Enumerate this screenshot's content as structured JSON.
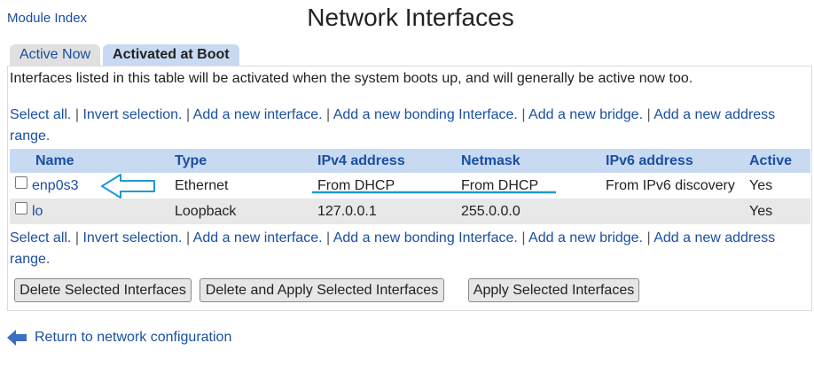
{
  "nav": {
    "module_index": "Module Index"
  },
  "page_title": "Network Interfaces",
  "tabs": [
    {
      "label": "Active Now",
      "active": false
    },
    {
      "label": "Activated at Boot",
      "active": true
    }
  ],
  "description": "Interfaces listed in this table will be activated when the system boots up, and will generally be active now too.",
  "actions": {
    "select_all": "Select all.",
    "invert_selection": "Invert selection.",
    "add_interface": "Add a new interface.",
    "add_bonding": "Add a new bonding Interface.",
    "add_bridge": "Add a new bridge.",
    "add_address_range_1": "Add a new address",
    "add_address_range_2": "range.",
    "separator": "|"
  },
  "table": {
    "headers": [
      "Name",
      "Type",
      "IPv4 address",
      "Netmask",
      "IPv6 address",
      "Active"
    ],
    "rows": [
      {
        "name": "enp0s3",
        "type": "Ethernet",
        "ipv4": "From DHCP",
        "netmask": "From DHCP",
        "ipv6": "From IPv6 discovery",
        "active": "Yes",
        "checked": false
      },
      {
        "name": "lo",
        "type": "Loopback",
        "ipv4": "127.0.0.1",
        "netmask": "255.0.0.0",
        "ipv6": "",
        "active": "Yes",
        "checked": false
      }
    ]
  },
  "buttons": {
    "delete_selected": "Delete Selected Interfaces",
    "delete_apply_selected": "Delete and Apply Selected Interfaces",
    "apply_selected": "Apply Selected Interfaces"
  },
  "return_link": "Return to network configuration",
  "colors": {
    "link": "#1a4fa0",
    "header_bg": "#c8daf2",
    "annotation": "#1e9ad6"
  },
  "icons": {
    "return": "left-arrow-icon",
    "annotation": "annotation-arrow-icon"
  }
}
